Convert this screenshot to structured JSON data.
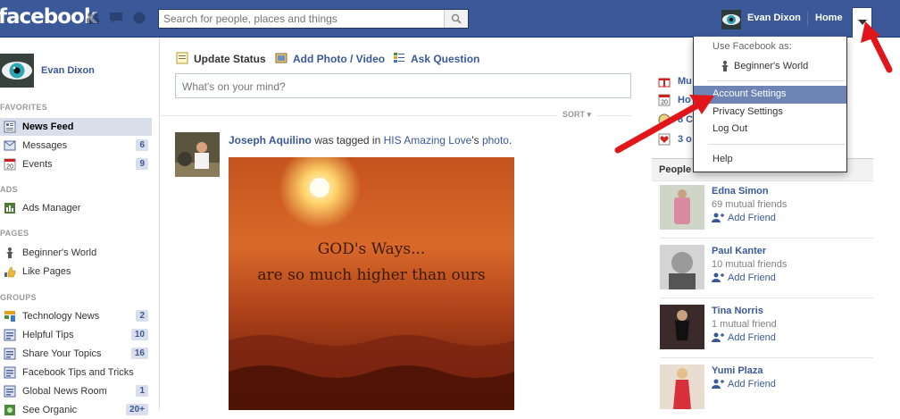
{
  "topbar": {
    "logo": "facebook",
    "search_placeholder": "Search for people, places and things",
    "user_name": "Evan Dixon",
    "home": "Home"
  },
  "sidebar": {
    "user_name": "Evan Dixon",
    "sections": {
      "favorites": "FAVORITES",
      "ads": "ADS",
      "pages": "PAGES",
      "groups": "GROUPS"
    },
    "favorites": [
      {
        "label": "News Feed",
        "icon": "news-feed-icon",
        "count": ""
      },
      {
        "label": "Messages",
        "icon": "messages-icon",
        "count": "6"
      },
      {
        "label": "Events",
        "icon": "calendar-icon",
        "count": "9"
      }
    ],
    "ads": [
      {
        "label": "Ads Manager",
        "icon": "ads-manager-icon"
      }
    ],
    "pages": [
      {
        "label": "Beginner's World",
        "icon": "page-icon"
      },
      {
        "label": "Like Pages",
        "icon": "like-pages-icon"
      }
    ],
    "groups": [
      {
        "label": "Technology News",
        "count": "2"
      },
      {
        "label": "Helpful Tips",
        "count": "10"
      },
      {
        "label": "Share Your Topics",
        "count": "16"
      },
      {
        "label": "Facebook Tips and Tricks",
        "count": ""
      },
      {
        "label": "Global News Room",
        "count": "1"
      },
      {
        "label": "See Organic",
        "count": "20+"
      }
    ]
  },
  "composer": {
    "tabs": [
      "Update Status",
      "Add Photo / Video",
      "Ask Question"
    ],
    "placeholder": "What's on your mind?",
    "sort": "SORT"
  },
  "story": {
    "actor": "Joseph Aquilino",
    "text1": " was tagged in ",
    "owner": "HIS Amazing Love",
    "text2": "'s ",
    "object": "photo",
    "text3": ".",
    "image_text_1": "GOD's Ways...",
    "image_text_2": "are so much higher than ours"
  },
  "right": {
    "links": [
      "Mu",
      "Ho",
      "8 C",
      "3 o"
    ],
    "pymk_title": "People",
    "add_friend": "Add Friend",
    "people": [
      {
        "name": "Edna Simon",
        "mutual": "69 mutual friends"
      },
      {
        "name": "Paul Kanter",
        "mutual": "10 mutual friends"
      },
      {
        "name": "Tina Norris",
        "mutual": "1 mutual friend"
      },
      {
        "name": "Yumi Plaza",
        "mutual": ""
      }
    ]
  },
  "dropdown": {
    "use_as": "Use Facebook as:",
    "page": "Beginner's World",
    "items": [
      "Account Settings",
      "Privacy Settings",
      "Log Out",
      "Help"
    ]
  },
  "colors": {
    "brand": "#3b5998",
    "highlight": "#6d84b4",
    "arrow": "#e0161a"
  }
}
